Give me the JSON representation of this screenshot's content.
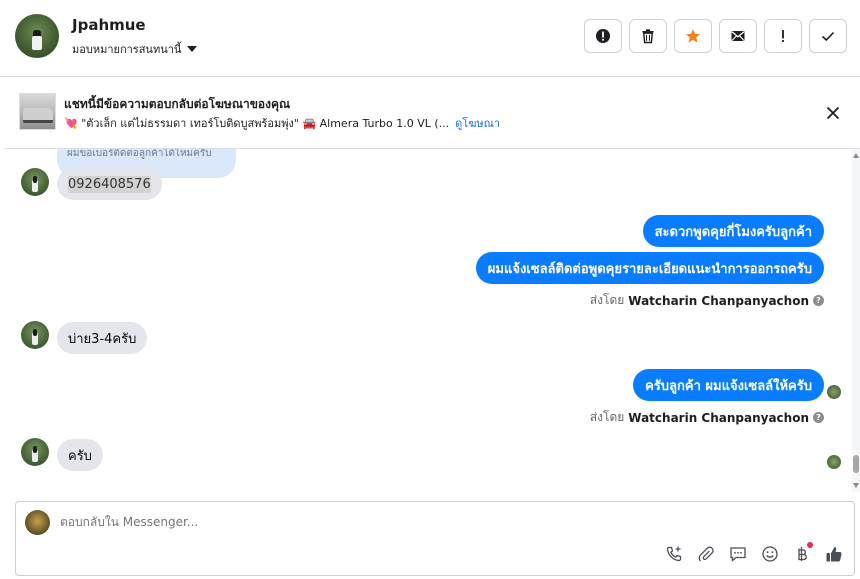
{
  "header": {
    "contact_name": "Jpahmue",
    "assign_label": "มอบหมายการสนทนานี้",
    "toolbar": [
      {
        "name": "spam-button",
        "icon": "alert-circle-icon"
      },
      {
        "name": "delete-button",
        "icon": "trash-icon"
      },
      {
        "name": "star-button",
        "icon": "star-icon",
        "color": "#f5821f"
      },
      {
        "name": "mark-unread-button",
        "icon": "envelope-icon"
      },
      {
        "name": "follow-up-button",
        "icon": "exclamation-icon"
      },
      {
        "name": "done-button",
        "icon": "check-icon"
      }
    ]
  },
  "ad_banner": {
    "title": "แชทนี้มีข้อความตอบกลับต่อโฆษณาของคุณ",
    "subtitle": "💘 \"ตัวเล็ก แต่ไม่ธรรมดา เทอร์โบติดบูสพร้อมพุ่ง\" 🚘 Almera Turbo 1.0 VL (...",
    "link": "ดูโฆษณา"
  },
  "thread": {
    "cut_off_message": "ผมขอเบอร์ติดต่อลูกค้าได้ไหมครับ",
    "messages": [
      {
        "direction": "in",
        "text": "0926408576"
      },
      {
        "direction": "out",
        "text": "สะดวกพูดคุยกี่โมงครับลูกค้า"
      },
      {
        "direction": "out",
        "text": "ผมแจ้งเซลล์ติดต่อพูดคุยรายละเอียดแนะนำการออกรถครับ"
      },
      {
        "direction": "in",
        "text": "บ่าย3-4ครับ"
      },
      {
        "direction": "out",
        "text": "ครับลูกค้า ผมแจ้งเซลล์ให้ครับ"
      },
      {
        "direction": "in",
        "text": "ครับ"
      }
    ],
    "sent_by_prefix": "ส่งโดย",
    "sent_by_name": "Watcharin Chanpanyachon",
    "help_mark": "?"
  },
  "composer": {
    "placeholder": "ตอบกลับใน Messenger...",
    "tools": [
      "phone-plus-icon",
      "paperclip-icon",
      "saved-replies-icon",
      "emoji-icon",
      "baht-icon",
      "thumbs-up-icon"
    ]
  },
  "colors": {
    "accent": "#0a7cff",
    "incoming": "#e4e6eb",
    "star": "#f5821f",
    "link": "#216fdb"
  }
}
